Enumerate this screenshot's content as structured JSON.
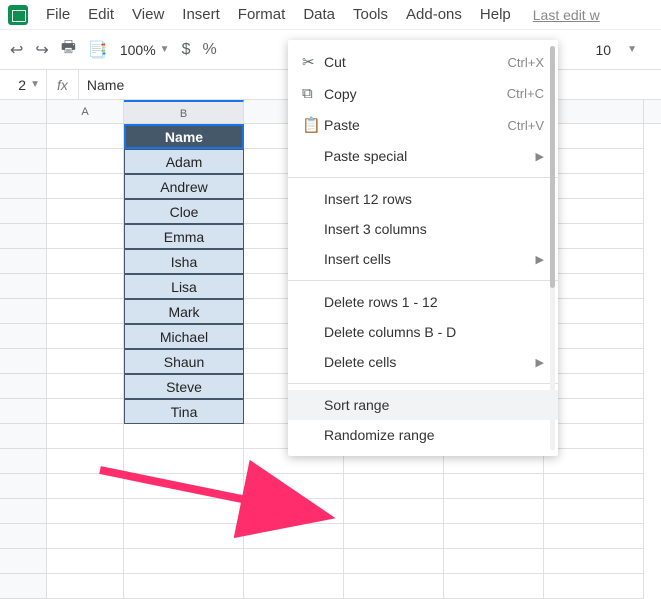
{
  "menubar": {
    "items": [
      "File",
      "Edit",
      "View",
      "Insert",
      "Format",
      "Data",
      "Tools",
      "Add-ons",
      "Help"
    ],
    "last_edit": "Last edit w"
  },
  "toolbar": {
    "zoom": "100%",
    "currency": "$",
    "percent": "%",
    "font_size": "10"
  },
  "formula_bar": {
    "cell_ref": "2",
    "fx": "fx",
    "value": "Name"
  },
  "columns": [
    "A",
    "B"
  ],
  "data_header": "Name",
  "names": [
    "Adam",
    "Andrew",
    "Cloe",
    "Emma",
    "Isha",
    "Lisa",
    "Mark",
    "Michael",
    "Shaun",
    "Steve",
    "Tina"
  ],
  "context_menu": {
    "cut": {
      "label": "Cut",
      "shortcut": "Ctrl+X"
    },
    "copy": {
      "label": "Copy",
      "shortcut": "Ctrl+C"
    },
    "paste": {
      "label": "Paste",
      "shortcut": "Ctrl+V"
    },
    "paste_special": "Paste special",
    "insert_rows": "Insert 12 rows",
    "insert_cols": "Insert 3 columns",
    "insert_cells": "Insert cells",
    "delete_rows": "Delete rows 1 - 12",
    "delete_cols": "Delete columns B - D",
    "delete_cells": "Delete cells",
    "sort_range": "Sort range",
    "randomize": "Randomize range"
  }
}
